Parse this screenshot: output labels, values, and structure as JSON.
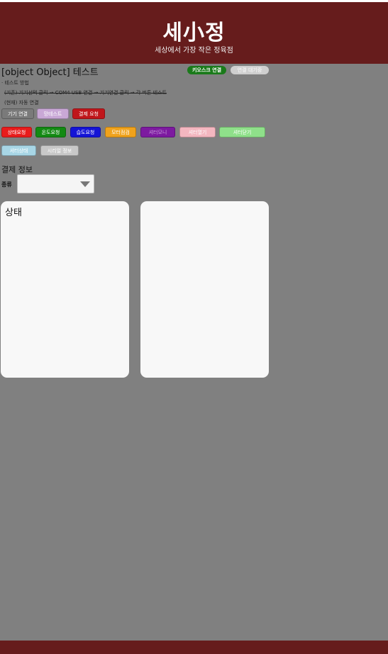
{
  "header": {
    "logo": "세小정",
    "tagline": "세상에서 가장 작은 정육점"
  },
  "page": {
    "title": "[object Object] 테스트",
    "kiosk_badge": "키오스크 연결",
    "wait_badge": "연결 대기중"
  },
  "instructions": {
    "heading": "· 테스트 방법",
    "steps": "(기존) 기기선택 클릭 → COM4 USB 연결 → 기기연결 클릭 → 각 버튼 테스트",
    "auto": "(현재) 자동 연결"
  },
  "buttons": [
    {
      "label": "기기 연결",
      "color": "#7a7a7a"
    },
    {
      "label": "망테스트",
      "color": "#c9a8d6"
    },
    {
      "label": "결제 요청",
      "color": "#c0161b"
    },
    {
      "label": "상태요청",
      "color": "#e81c1c"
    },
    {
      "label": "온도요청",
      "color": "#138a13"
    },
    {
      "label": "습도요청",
      "color": "#1414d6"
    },
    {
      "label": "모터점검",
      "color": "#f0a21c"
    },
    {
      "label": "셔터모니",
      "color": "#7d1aa0"
    },
    {
      "label": "셔터열기",
      "color": "#f4b7c0"
    },
    {
      "label": "셔터닫기",
      "color": "#8fe08a"
    },
    {
      "label": "셔터상태",
      "color": "#a8d6e6"
    },
    {
      "label": "시리얼 정보",
      "color": "#c8c8c8"
    }
  ],
  "payment": {
    "section_title": "결제 정보",
    "type_label": "종류",
    "type_value": ""
  },
  "panels": {
    "status_title": "상태",
    "right_title": ""
  },
  "colors": {
    "header": "#661c1c",
    "background": "#808080",
    "panel": "#f8f8f8"
  }
}
